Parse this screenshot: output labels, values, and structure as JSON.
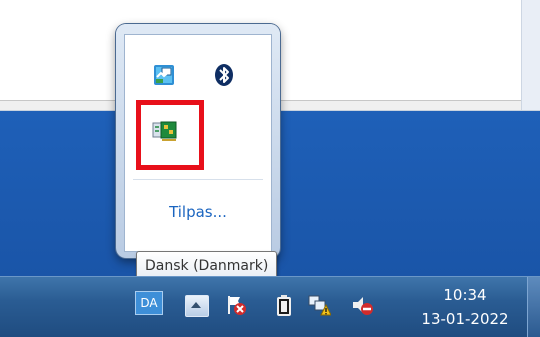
{
  "tray_popup": {
    "customize_label": "Tilpas...",
    "icons": [
      {
        "name": "network-monitor-icon"
      },
      {
        "name": "bluetooth-icon"
      },
      {
        "name": "network-adapter-icon",
        "highlighted": true
      }
    ],
    "highlight_color": "#e8101a"
  },
  "tooltip": {
    "text": "Dansk (Danmark)"
  },
  "taskbar": {
    "language_indicator": "DA",
    "clock": {
      "time": "10:34",
      "date": "13-01-2022"
    },
    "icons": [
      {
        "name": "show-hidden-icons-button"
      },
      {
        "name": "action-center-flag-icon"
      },
      {
        "name": "battery-icon"
      },
      {
        "name": "network-warning-icon"
      },
      {
        "name": "volume-muted-icon"
      }
    ]
  }
}
